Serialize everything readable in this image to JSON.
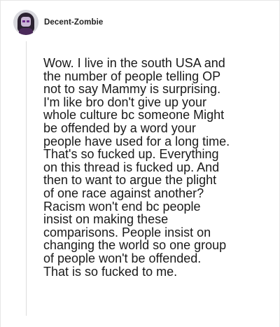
{
  "post": {
    "username": "Decent-Zombie",
    "avatar_icon": "user-avatar-icon",
    "comment_lines": [
      "Wow. I live in the south USA and",
      "the number of people telling OP",
      "not to say Mammy is surprising.",
      "I'm like bro don't give up your",
      "whole culture bc someone Might",
      "be offended by a word your",
      "people have used for a long time.",
      "That's so fucked up. Everything",
      "on this thread is fucked up. And",
      "then to want to argue the plight",
      "of one race against another?",
      "Racism won't end bc people",
      "insist on making these",
      "comparisons. People insist on",
      "changing the world so one group",
      "of people won't be offended.",
      "That is so fucked to me."
    ]
  }
}
